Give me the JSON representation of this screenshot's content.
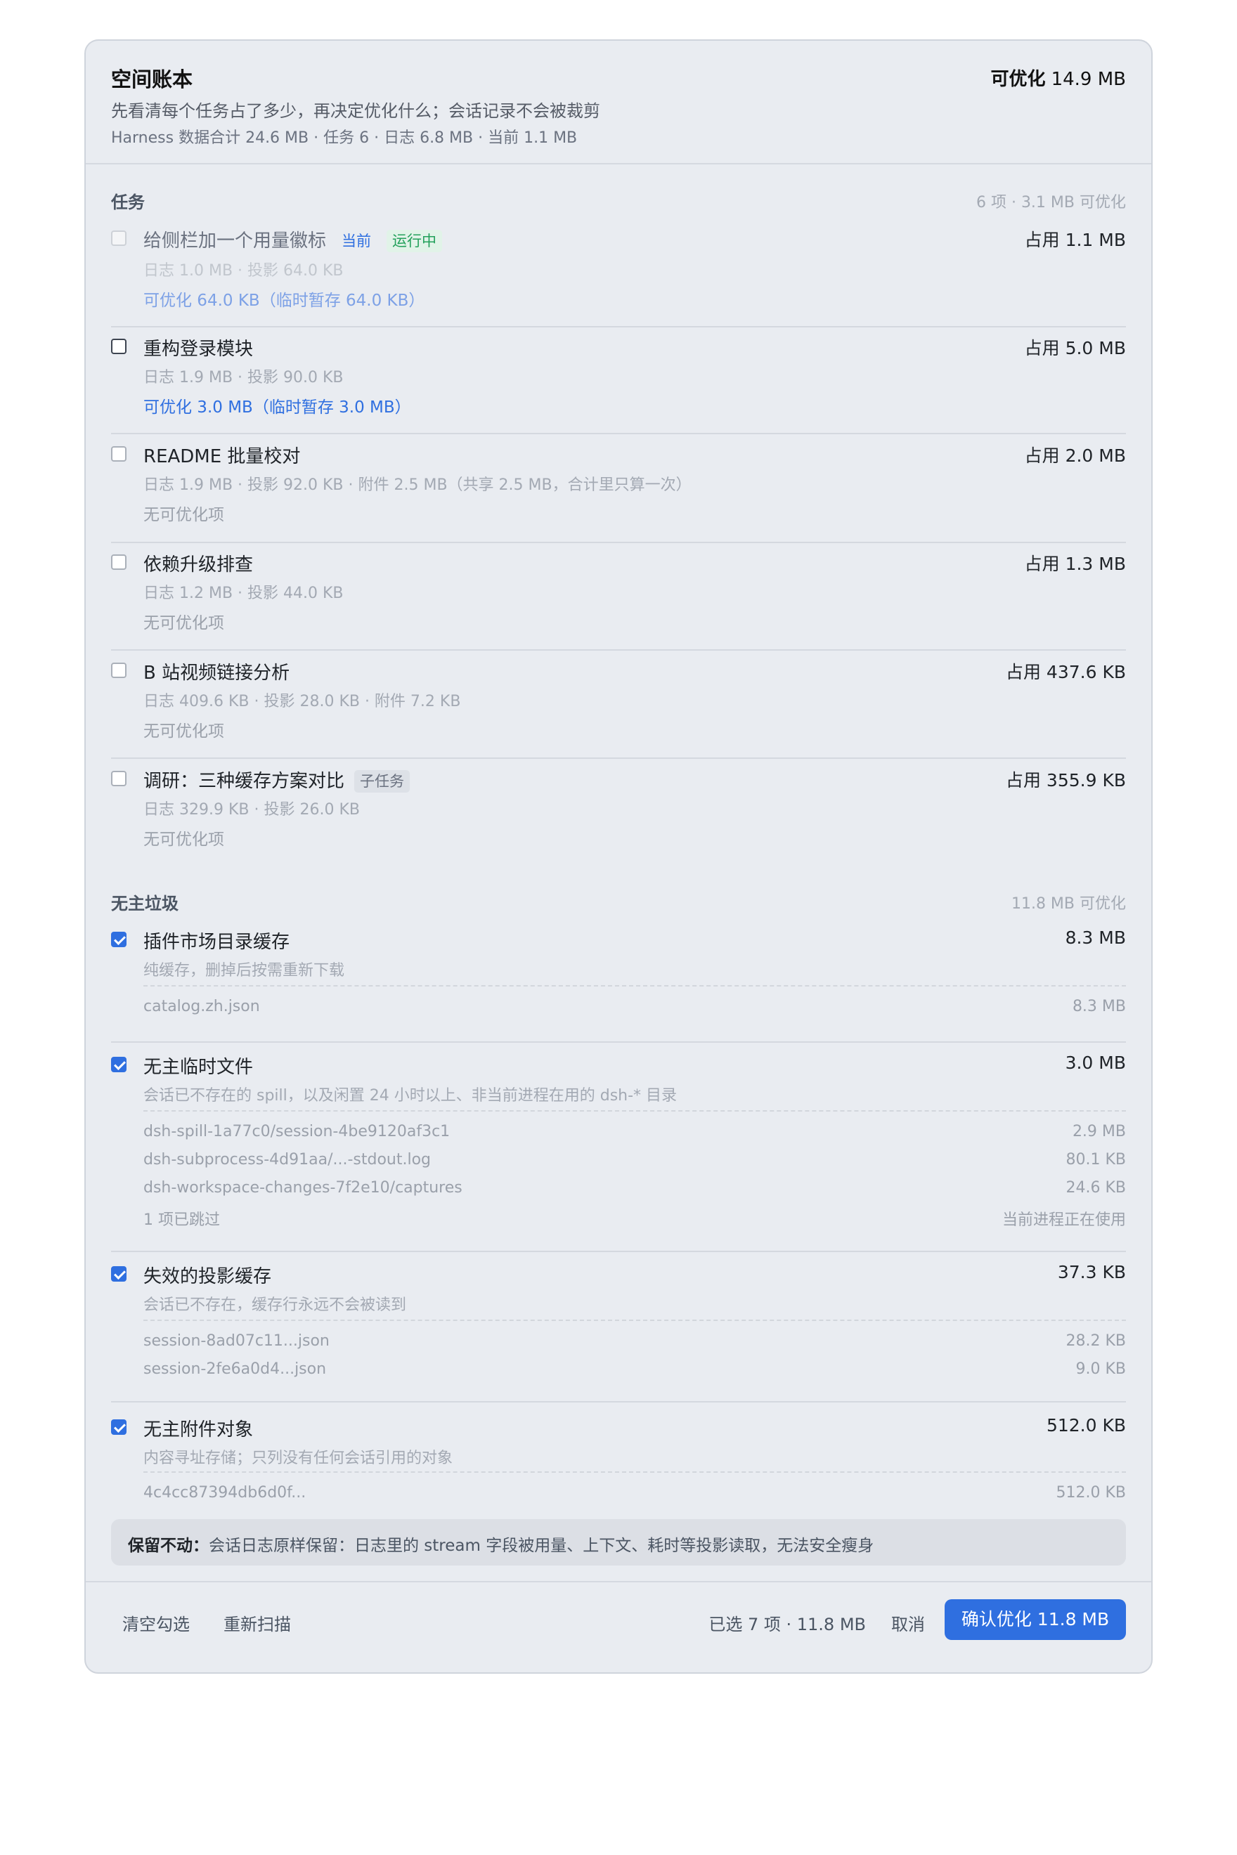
{
  "header": {
    "title": "空间账本",
    "optimizable_label": "可优化",
    "optimizable_value": "14.9 MB",
    "subtitle": "先看清每个任务占了多少，再决定优化什么；会话记录不会被裁剪",
    "meta": "Harness 数据合计 24.6 MB · 任务 6 · 日志 6.8 MB · 当前 1.1 MB"
  },
  "tasks_section": {
    "title": "任务",
    "note": "6 项 · 3.1 MB 可优化",
    "items": [
      {
        "name": "给侧栏加一个用量徽标",
        "tag_current": "当前",
        "tag_running": "运行中",
        "size": "占用 1.1 MB",
        "detail": "日志 1.0 MB · 投影 64.0 KB",
        "optimize": "可优化 64.0 KB（临时暂存 64.0 KB）"
      },
      {
        "name": "重构登录模块",
        "size": "占用 5.0 MB",
        "detail": "日志 1.9 MB · 投影 90.0 KB",
        "optimize": "可优化 3.0 MB（临时暂存 3.0 MB）"
      },
      {
        "name": "README 批量校对",
        "size": "占用 2.0 MB",
        "detail": "日志 1.9 MB · 投影 92.0 KB · 附件 2.5 MB（共享 2.5 MB，合计里只算一次）",
        "optimize": "无可优化项"
      },
      {
        "name": "依赖升级排查",
        "size": "占用 1.3 MB",
        "detail": "日志 1.2 MB · 投影 44.0 KB",
        "optimize": "无可优化项"
      },
      {
        "name": "B 站视频链接分析",
        "size": "占用 437.6 KB",
        "detail": "日志 409.6 KB · 投影 28.0 KB · 附件 7.2 KB",
        "optimize": "无可优化项"
      },
      {
        "name": "调研：三种缓存方案对比",
        "tag_sub": "子任务",
        "size": "占用 355.9 KB",
        "detail": "日志 329.9 KB · 投影 26.0 KB",
        "optimize": "无可优化项"
      }
    ]
  },
  "orphans_section": {
    "title": "无主垃圾",
    "note": "11.8 MB 可优化",
    "groups": [
      {
        "name": "插件市场目录缓存",
        "size": "8.3 MB",
        "desc": "纯缓存，删掉后按需重新下载",
        "files": [
          {
            "name": "catalog.zh.json",
            "size": "8.3 MB"
          }
        ]
      },
      {
        "name": "无主临时文件",
        "size": "3.0 MB",
        "desc": "会话已不存在的 spill，以及闲置 24 小时以上、非当前进程在用的 dsh-* 目录",
        "files": [
          {
            "name": "dsh-spill-1a77c0/session-4be9120af3c1",
            "size": "2.9 MB"
          },
          {
            "name": "dsh-subprocess-4d91aa/...-stdout.log",
            "size": "80.1 KB"
          },
          {
            "name": "dsh-workspace-changes-7f2e10/captures",
            "size": "24.6 KB"
          },
          {
            "name": "1 项已跳过",
            "size": "当前进程正在使用"
          }
        ]
      },
      {
        "name": "失效的投影缓存",
        "size": "37.3 KB",
        "desc": "会话已不存在，缓存行永远不会被读到",
        "files": [
          {
            "name": "session-8ad07c11...json",
            "size": "28.2 KB"
          },
          {
            "name": "session-2fe6a0d4...json",
            "size": "9.0 KB"
          }
        ]
      },
      {
        "name": "无主附件对象",
        "size": "512.0 KB",
        "desc": "内容寻址存储；只列没有任何会话引用的对象",
        "files": [
          {
            "name": "4c4cc87394db6d0f...",
            "size": "512.0 KB"
          }
        ]
      }
    ]
  },
  "notice": {
    "label": "保留不动：",
    "text": "会话日志原样保留：日志里的 stream 字段被用量、上下文、耗时等投影读取，无法安全瘦身"
  },
  "footer": {
    "clear_label": "清空勾选",
    "rescan_label": "重新扫描",
    "selected_summary": "已选 7 项 · 11.8 MB",
    "cancel_label": "取消",
    "confirm_label": "确认优化 11.8 MB"
  },
  "colors": {
    "accent": "#2f6fe0",
    "running_green": "#22a05a",
    "panel_bg": "#e9ecf1"
  }
}
